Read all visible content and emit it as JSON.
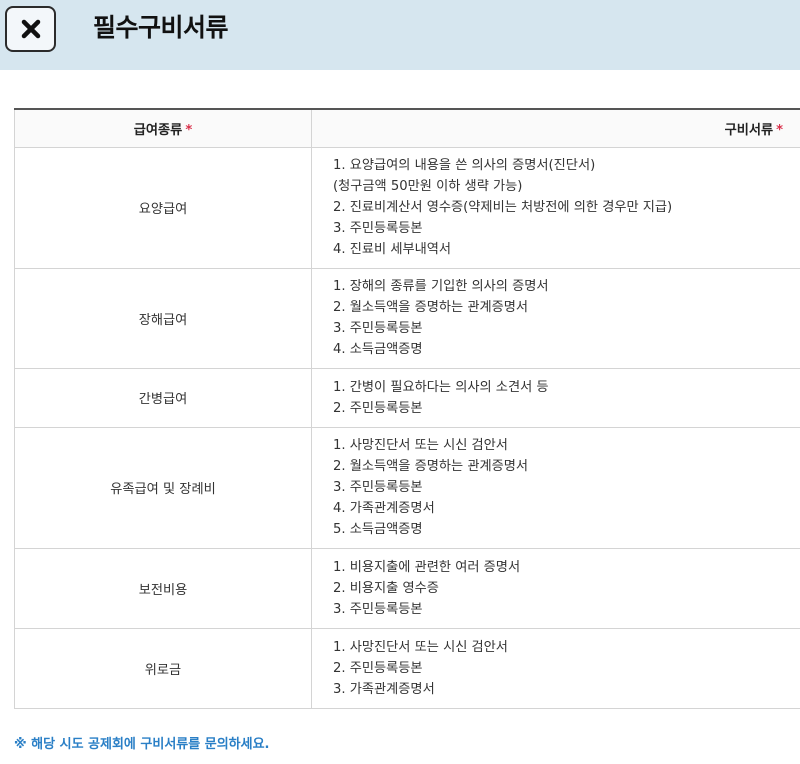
{
  "header": {
    "title": "필수구비서류",
    "close_icon": "close-icon",
    "background_color": "#d6e6ef"
  },
  "table": {
    "columns": [
      {
        "label": "급여종류",
        "required_mark": "*"
      },
      {
        "label": "구비서류",
        "required_mark": "*"
      }
    ],
    "rows": [
      {
        "type": "요양급여",
        "docs": [
          "1. 요양급여의 내용을 쓴 의사의 증명서(진단서)",
          "(청구금액 50만원 이하 생략 가능)",
          "2. 진료비계산서 영수증(약제비는 처방전에 의한 경우만 지급)",
          "3. 주민등록등본",
          "4. 진료비 세부내역서"
        ]
      },
      {
        "type": "장해급여",
        "docs": [
          "1. 장해의 종류를 기입한 의사의 증명서",
          "2. 월소득액을 증명하는 관계증명서",
          "3. 주민등록등본",
          "4. 소득금액증명"
        ]
      },
      {
        "type": "간병급여",
        "docs": [
          "1. 간병이 필요하다는 의사의 소견서 등",
          "2. 주민등록등본"
        ]
      },
      {
        "type": "유족급여 및 장례비",
        "docs": [
          "1. 사망진단서 또는 시신 검안서",
          "2. 월소득액을 증명하는 관계증명서",
          "3. 주민등록등본",
          "4. 가족관계증명서",
          "5. 소득금액증명"
        ]
      },
      {
        "type": "보전비용",
        "docs": [
          "1. 비용지출에 관련한 여러 증명서",
          "2. 비용지출 영수증",
          "3. 주민등록등본"
        ]
      },
      {
        "type": "위로금",
        "docs": [
          "1. 사망진단서 또는 시신 검안서",
          "2. 주민등록등본",
          "3. 가족관계증명서"
        ]
      }
    ]
  },
  "note": {
    "text": "※ 해당 시도 공제회에 구비서류를 문의하세요.",
    "color": "#2a7fc6"
  },
  "colors": {
    "required_mark": "#d9304b",
    "table_top_border": "#555555"
  }
}
